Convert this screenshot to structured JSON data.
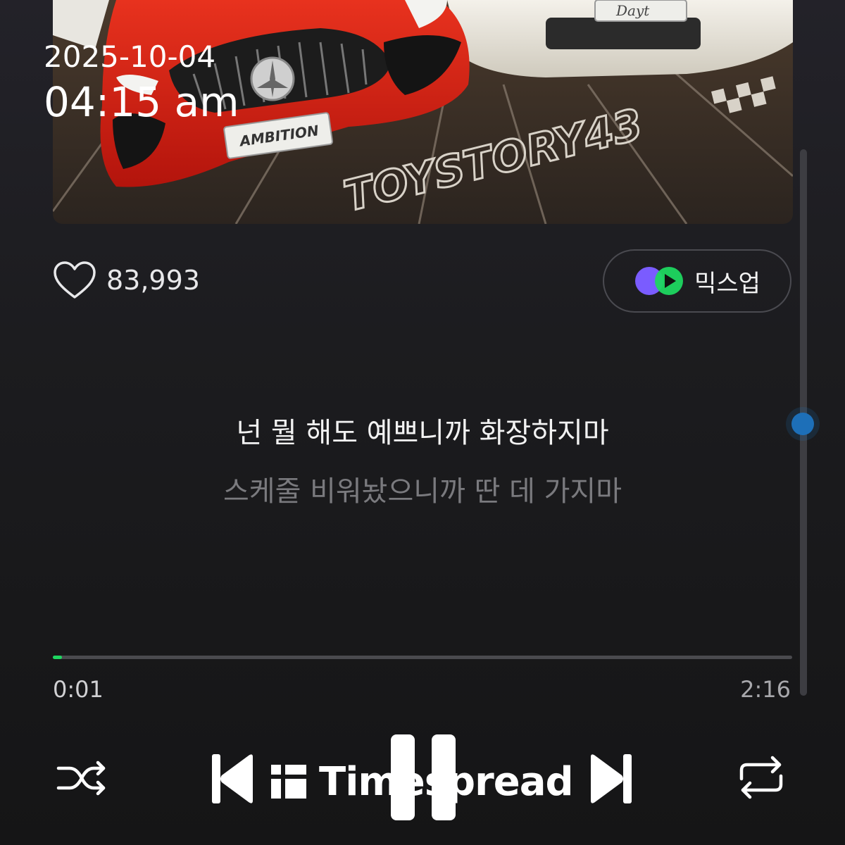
{
  "overlay": {
    "date": "2025-10-04",
    "time": "04:15 am"
  },
  "album_art": {
    "icon": "album-artwork",
    "plate_left": "AMBITION",
    "plate_right": "Dayt",
    "road_text": "TOYSTORY43"
  },
  "like": {
    "icon": "heart-icon",
    "count": "83,993"
  },
  "mixup": {
    "label": "믹스업",
    "icon": "mixup-icon",
    "colors": [
      "#7a5cff",
      "#1ed760"
    ]
  },
  "lyrics": {
    "current": "넌 뭘 해도 예쁘니까 화장하지마",
    "next": "스케줄 비워놨으니까 딴 데 가지마"
  },
  "playback": {
    "elapsed": "0:01",
    "total": "2:16",
    "progress_fraction": 0.012,
    "accent_color": "#1ed760"
  },
  "controls": {
    "shuffle_icon": "shuffle-icon",
    "previous_icon": "skip-previous-icon",
    "pause_icon": "pause-icon",
    "next_icon": "skip-next-icon",
    "repeat_icon": "repeat-icon"
  },
  "watermark": {
    "text": "Timespread",
    "icon": "timespread-logo-icon"
  }
}
